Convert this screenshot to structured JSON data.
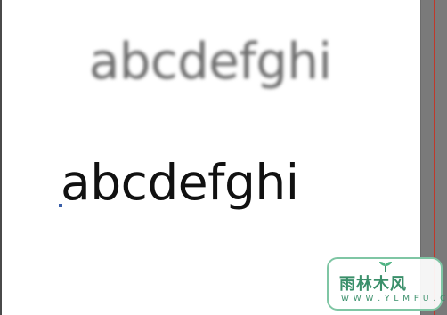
{
  "canvas": {
    "blurred_sample": "abcdefghi",
    "sharp_sample": "abcdefghi"
  },
  "watermark": {
    "title": "雨林木风",
    "subtitle": "W W W . Y L M F U . C O M",
    "brand_color": "#3a8f6a"
  },
  "colors": {
    "canvas_bg": "#ffffff",
    "guide_line": "#c0392b",
    "baseline": "#4a6fb0"
  }
}
